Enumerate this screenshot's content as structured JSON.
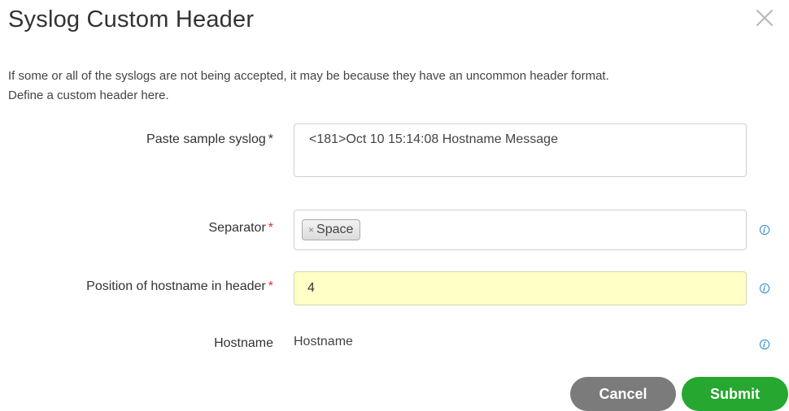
{
  "dialog": {
    "title": "Syslog Custom Header",
    "intro_line1": "If some or all of the syslogs are not being accepted, it may be because they have an uncommon header format.",
    "intro_line2": "Define a custom header here."
  },
  "form": {
    "sample": {
      "label": "Paste sample syslog",
      "required_mark": "*",
      "value": "<181>Oct 10 15:14:08 Hostname Message"
    },
    "separator": {
      "label": "Separator",
      "required_mark": "*",
      "tag_remove": "×",
      "tag_label": "Space"
    },
    "position": {
      "label": "Position of hostname in header",
      "required_mark": "*",
      "value": "4"
    },
    "hostname": {
      "label": "Hostname",
      "value": "Hostname"
    }
  },
  "buttons": {
    "cancel": "Cancel",
    "submit": "Submit"
  },
  "colors": {
    "required_star": "#d9342b",
    "submit_green": "#26a72f",
    "cancel_gray": "#7b7b7b",
    "highlight_field": "#ffffc6",
    "info_icon": "#3a8fd6"
  },
  "icons": {
    "close": "close-icon",
    "info": "info-icon"
  }
}
